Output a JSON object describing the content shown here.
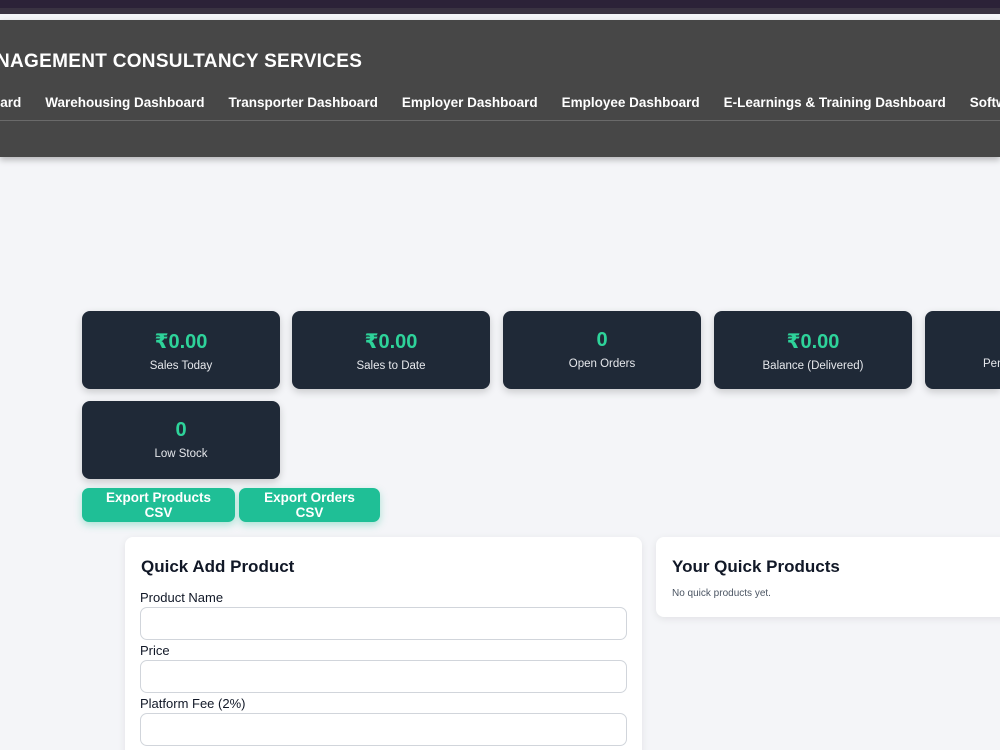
{
  "header": {
    "title": "NAGEMENT CONSULTANCY SERVICES",
    "nav": [
      "oard",
      "Warehousing Dashboard",
      "Transporter Dashboard",
      "Employer Dashboard",
      "Employee Dashboard",
      "E-Learnings & Training Dashboard",
      "Softwar"
    ]
  },
  "stats": [
    {
      "value": "₹0.00",
      "label": "Sales Today"
    },
    {
      "value": "₹0.00",
      "label": "Sales to Date"
    },
    {
      "value": "0",
      "label": "Open Orders"
    },
    {
      "value": "₹0.00",
      "label": "Balance (Delivered)"
    },
    {
      "value": "",
      "label": "Pen"
    },
    {
      "value": "0",
      "label": "Low Stock"
    }
  ],
  "actions": {
    "export_products": "Export Products CSV",
    "export_orders": "Export Orders CSV"
  },
  "quick_add": {
    "title": "Quick Add Product",
    "fields": [
      {
        "label": "Product Name",
        "value": ""
      },
      {
        "label": "Price",
        "value": ""
      },
      {
        "label": "Platform Fee (2%)",
        "value": ""
      }
    ]
  },
  "quick_products": {
    "title": "Your Quick Products",
    "empty_text": "No quick products yet."
  },
  "colors": {
    "accent": "#1fbf96",
    "stat_value": "#2ed39a",
    "card_bg": "#1f2937",
    "header_bg": "#474747"
  }
}
